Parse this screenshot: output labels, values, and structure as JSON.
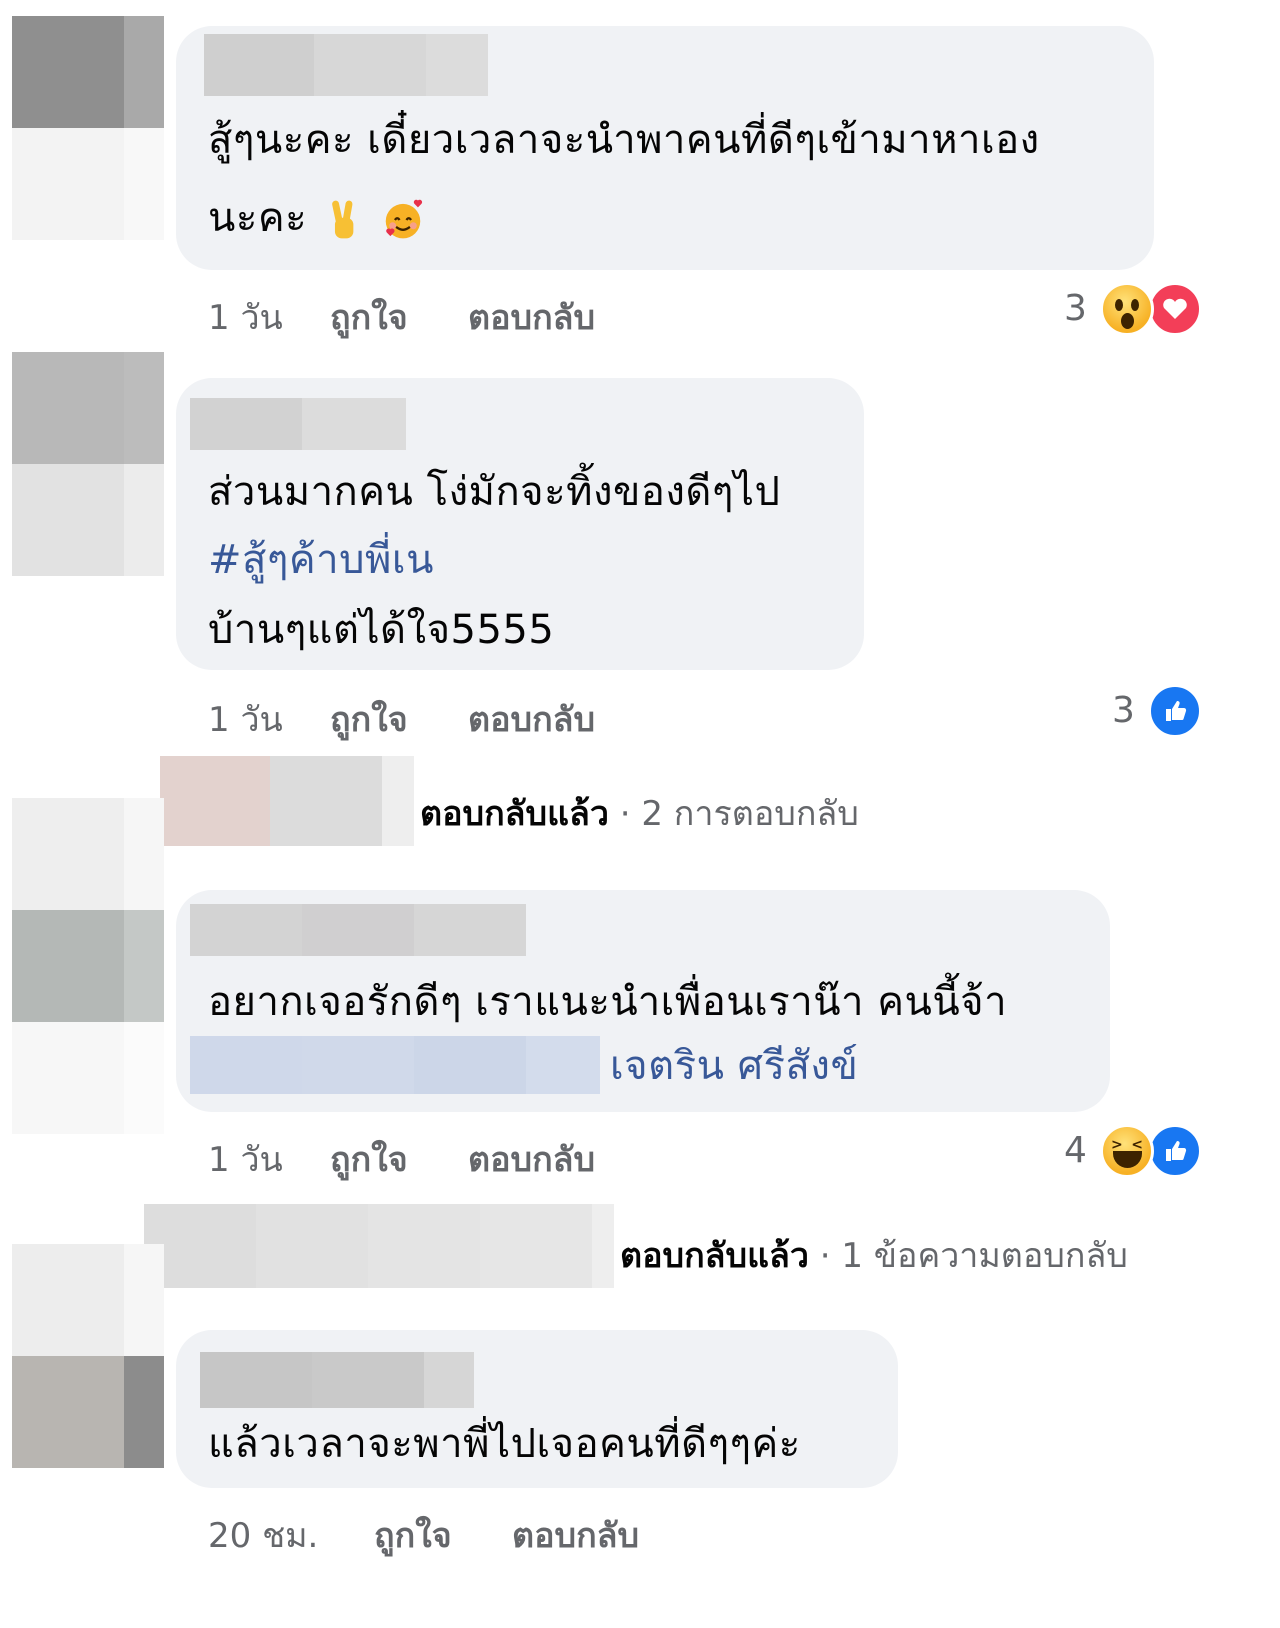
{
  "comments": [
    {
      "lines": [
        "สู้ๆนะคะ เดี๋ยวเวลาจะนำพาคนที่ดีๆเข้ามาหาเอง",
        "นะคะ"
      ],
      "emojis": [
        "victory-hand",
        "smiling-face-with-hearts"
      ],
      "time": "1 วัน",
      "like": "ถูกใจ",
      "reply": "ตอบกลับ",
      "reaction_count": "3",
      "reactions": [
        "wow",
        "love"
      ]
    },
    {
      "lines": [
        "ส่วนมากคน โง่มักจะทิ้งของดีๆไป",
        "#สู้ๆค้าบพี่เน",
        "บ้านๆแต่ได้ใจ5555"
      ],
      "time": "1 วัน",
      "like": "ถูกใจ",
      "reply": "ตอบกลับ",
      "reaction_count": "3",
      "reactions": [
        "like"
      ],
      "replies_label": "ตอบกลับแล้ว",
      "replies_count": "· 2 การตอบกลับ"
    },
    {
      "lines": [
        "อยากเจอรักดีๆ เราแนะนำเพื่อนเราน๊า คนนี้จ้า"
      ],
      "mention": "เจตริน ศรีสังข์",
      "time": "1 วัน",
      "like": "ถูกใจ",
      "reply": "ตอบกลับ",
      "reaction_count": "4",
      "reactions": [
        "haha",
        "like"
      ],
      "replies_label": "ตอบกลับแล้ว",
      "replies_count": "· 1 ข้อความตอบกลับ"
    },
    {
      "lines": [
        "แล้วเวลาจะพาพี่ไปเจอคนที่ดีๆๆค่ะ"
      ],
      "time": "20 ชม.",
      "like": "ถูกใจ",
      "reply": "ตอบกลับ"
    }
  ],
  "colors": {
    "bubble": "#f0f2f5",
    "link": "#385898",
    "meta": "#65676b",
    "like_blue": "#1877f2",
    "love_red": "#f33e58"
  }
}
